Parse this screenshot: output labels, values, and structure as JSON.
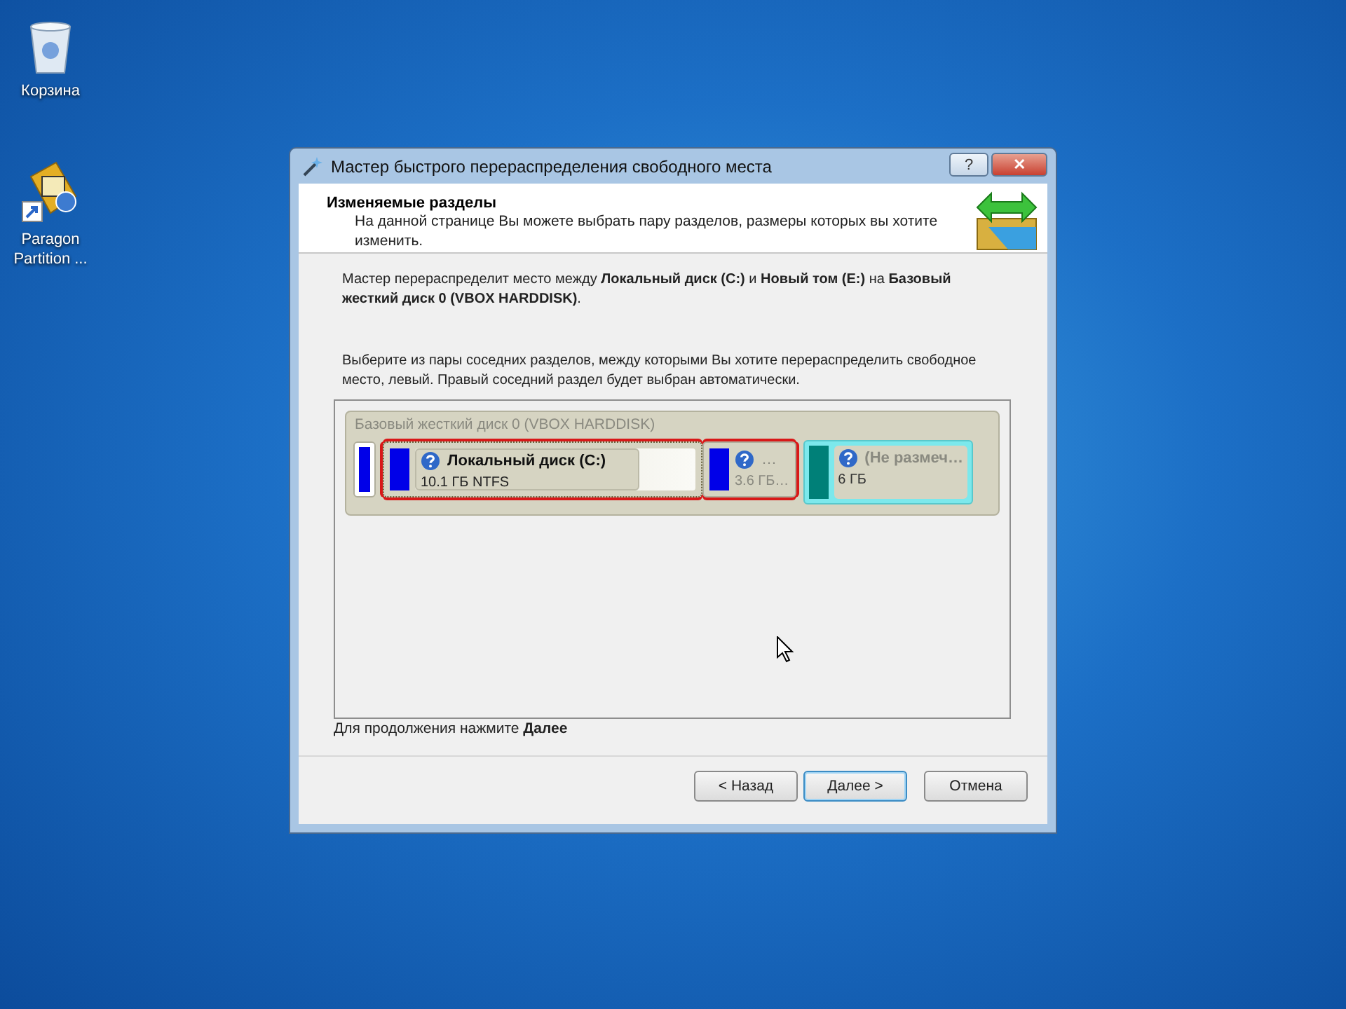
{
  "desktop_icons": [
    {
      "kind": "recycle",
      "label": "Корзина"
    },
    {
      "kind": "shortcut",
      "label": "Paragon Partition ..."
    }
  ],
  "window": {
    "title": "Мастер быстрого перераспределения свободного места",
    "title_buttons": [
      "?",
      "✕"
    ]
  },
  "header": {
    "title": "Изменяемые разделы",
    "subtitle": "На данной странице Вы можете выбрать пару разделов, размеры которых вы хотите изменить."
  },
  "intro": "Мастер перераспределит место между **Локальный диск (C:)** и **Новый том (E:)** на **Базовый жесткий диск 0 (VBOX HARDDISK)**.",
  "instruction": "Выберите из пары соседних разделов, между которыми Вы хотите перераспределить свободное место, левый. Правый соседний раздел будет выбран автоматически.",
  "disk": {
    "title": "Базовый жесткий диск 0 (VBOX HARDDISK)",
    "partitions": [
      {
        "kind": "stub",
        "color": "#0000e8",
        "selected": false,
        "paired": false,
        "hovered": false
      },
      {
        "kind": "volume",
        "name": "Локальный диск (C:)",
        "size": "10.1 ГБ NTFS",
        "color": "#0000e8",
        "level": 0.8,
        "selected": true,
        "paired": true,
        "hovered": false
      },
      {
        "kind": "volume",
        "name": "…",
        "size": "3.6 ГБ…",
        "color": "#0000e8",
        "selected": false,
        "paired": true,
        "hovered": false
      },
      {
        "kind": "volume",
        "name": "(Не размеч…",
        "size": "6 ГБ",
        "color": "#008078",
        "selected": false,
        "paired": false,
        "hovered": true
      }
    ]
  },
  "footer_hint": "Для продолжения нажмите **Далее**",
  "buttons": [
    {
      "label": "< Назад",
      "default": false
    },
    {
      "label": "Далее >",
      "default": true
    },
    {
      "label": "Отмена",
      "default": false
    }
  ]
}
